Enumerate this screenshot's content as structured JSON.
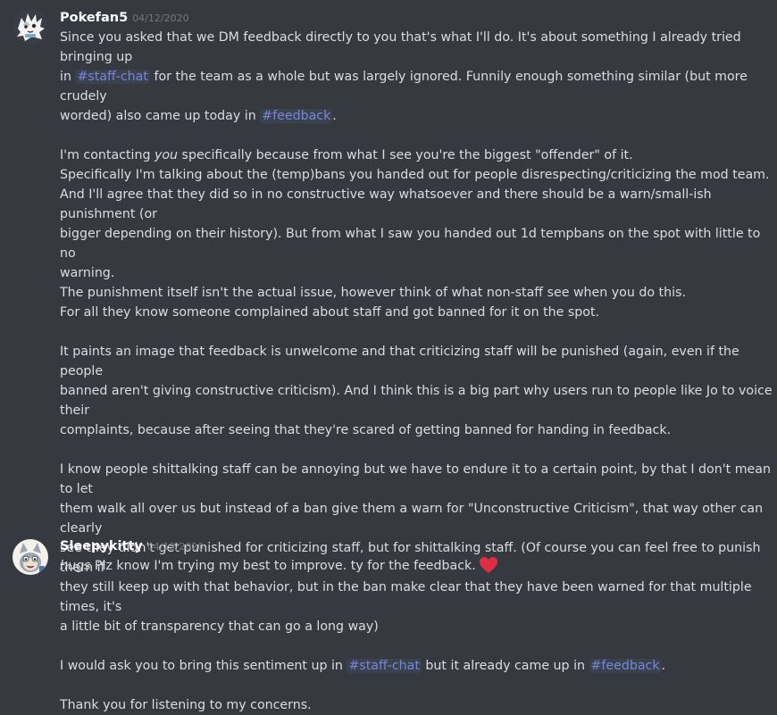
{
  "messages": [
    {
      "author": "Pokefan5",
      "timestamp": "04/12/2020",
      "avatar_icon": "white-spiky-creature-avatar",
      "lines": {
        "p1_a": "Since you asked that we DM feedback directly to you that's what I'll do. It's about something I already tried bringing up",
        "p1_b_pre": "in ",
        "p1_b_mention": "#staff-chat",
        "p1_b_post": " for the team as a whole but was largely ignored. Funnily enough something similar (but more crudely",
        "p1_c_pre": "worded) also came up today in ",
        "p1_c_mention": "#feedback",
        "p1_c_post": ".",
        "p2_a_pre": "I'm contacting ",
        "p2_a_em": "you",
        "p2_a_post": " specifically because from what I see you're the biggest \"offender\" of it.",
        "p2_b": "Specifically I'm talking about the (temp)bans you handed out for people disrespecting/criticizing the mod team.",
        "p2_c": "And I'll agree that they did so in no constructive way whatsoever and there should be a warn/small-ish punishment (or",
        "p2_d": "bigger depending on their history). But from what I saw you handed out 1d tempbans on the spot with little to no",
        "p2_e": "warning.",
        "p2_f": "The punishment itself isn't the actual issue, however think of what non-staff see when you do this.",
        "p2_g": "For all they know someone complained about staff and got banned for it on the spot.",
        "p3_a": "It paints an image that feedback is unwelcome and that criticizing staff will be punished (again, even if the people",
        "p3_b": "banned aren't giving constructive criticism). And I think this is a big part why users run to people like Jo to voice their",
        "p3_c": "complaints, because after seeing that they're scared of getting banned for handing in feedback.",
        "p4_a": "I know people shittalking staff can be annoying but we have to endure it to a certain point, by that I don't mean to let",
        "p4_b": "them walk all over us but instead of a ban give them a warn for \"Unconstructive Criticism\", that way other can clearly",
        "p4_c": "see they didn't get punished for criticizing staff, but for shittalking staff. (Of course you can feel free to punish them if",
        "p4_d": "they still keep up with that behavior, but in the ban make clear that they have been warned for that multiple times, it's",
        "p4_e": "a little bit of transparency that can go a long way)",
        "p5_pre": "I would ask you to bring this sentiment up in ",
        "p5_mention1": "#staff-chat",
        "p5_mid": " but it already came up in ",
        "p5_mention2": "#feedback",
        "p5_post": ".",
        "p6": "Thank you for listening to my concerns."
      }
    },
    {
      "author": "Sleepykitty",
      "timestamp": "04/12/2020",
      "avatar_icon": "cartoon-kitty-avatar",
      "lines": {
        "em": "hugs",
        "text": " Plz know I'm trying my best to improve.  ty for the feedback.",
        "emoji": "red-heart-icon"
      }
    }
  ],
  "colors": {
    "background": "#36393f",
    "mention": "#7289da",
    "username": "#ffffff",
    "timestamp": "#72767d",
    "text": "#dcddde",
    "heart": "#dd2e44"
  }
}
